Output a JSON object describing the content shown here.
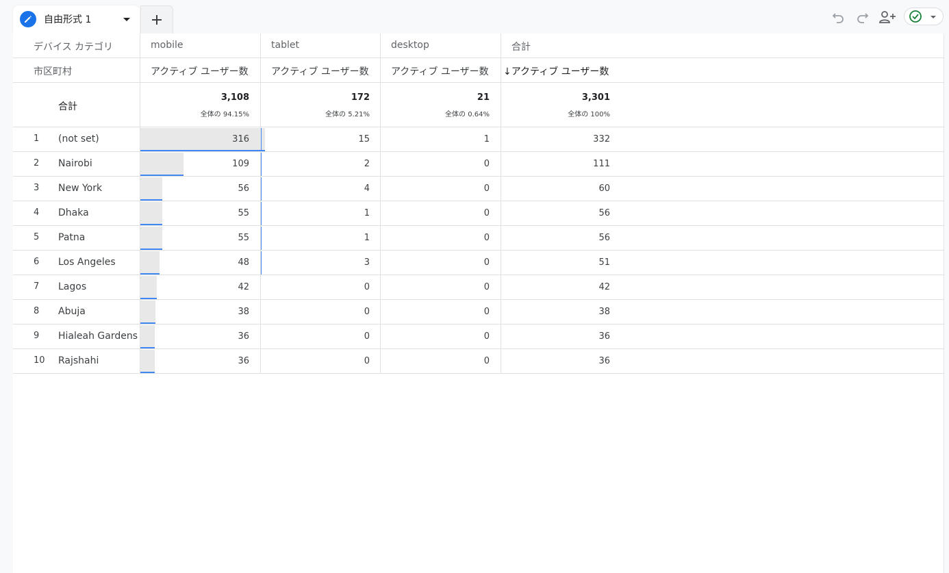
{
  "tabs": [
    {
      "label": "自由形式 1"
    }
  ],
  "toolbar": {
    "undo_icon": "undo-icon",
    "redo_icon": "redo-icon",
    "share_icon": "person-add-icon",
    "status_icon": "check-circle-icon"
  },
  "table": {
    "dimension_header": "デバイス カテゴリ",
    "row_dimension_header": "市区町村",
    "columns": [
      {
        "name": "mobile",
        "metric": "アクティブ ユーザー数",
        "total": "3,108",
        "pct": "全体の 94.15%"
      },
      {
        "name": "tablet",
        "metric": "アクティブ ユーザー数",
        "total": "172",
        "pct": "全体の 5.21%"
      },
      {
        "name": "desktop",
        "metric": "アクティブ ユーザー数",
        "total": "21",
        "pct": "全体の 0.64%"
      },
      {
        "name": "合計",
        "metric": "↓アクティブ ユーザー数",
        "total": "3,301",
        "pct": "全体の 100%"
      }
    ],
    "total_label": "合計",
    "rows": [
      {
        "rank": "1",
        "city": "(not set)",
        "values": [
          316,
          15,
          1,
          332
        ]
      },
      {
        "rank": "2",
        "city": "Nairobi",
        "values": [
          109,
          2,
          0,
          111
        ]
      },
      {
        "rank": "3",
        "city": "New York",
        "values": [
          56,
          4,
          0,
          60
        ]
      },
      {
        "rank": "4",
        "city": "Dhaka",
        "values": [
          55,
          1,
          0,
          56
        ]
      },
      {
        "rank": "5",
        "city": "Patna",
        "values": [
          55,
          1,
          0,
          56
        ]
      },
      {
        "rank": "6",
        "city": "Los Angeles",
        "values": [
          48,
          3,
          0,
          51
        ]
      },
      {
        "rank": "7",
        "city": "Lagos",
        "values": [
          42,
          0,
          0,
          42
        ]
      },
      {
        "rank": "8",
        "city": "Abuja",
        "values": [
          38,
          0,
          0,
          38
        ]
      },
      {
        "rank": "9",
        "city": "Hialeah Gardens",
        "values": [
          36,
          0,
          0,
          36
        ]
      },
      {
        "rank": "10",
        "city": "Rajshahi",
        "values": [
          36,
          0,
          0,
          36
        ]
      }
    ]
  },
  "colors": {
    "accent": "#1a73e8",
    "bar_line": "#4285f4",
    "bar_fill": "#e8e8e8",
    "status_green": "#188038"
  }
}
